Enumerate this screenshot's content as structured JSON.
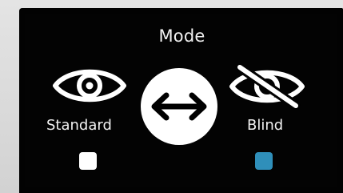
{
  "mode": {
    "title": "Mode",
    "standard": {
      "label": "Standard",
      "icon": "eye-icon",
      "indicator_color": "#ffffff"
    },
    "blind": {
      "label": "Blind",
      "icon": "eye-slash-icon",
      "indicator_color": "#2f8fba"
    },
    "toggle": {
      "icon": "double-arrow-icon"
    }
  }
}
